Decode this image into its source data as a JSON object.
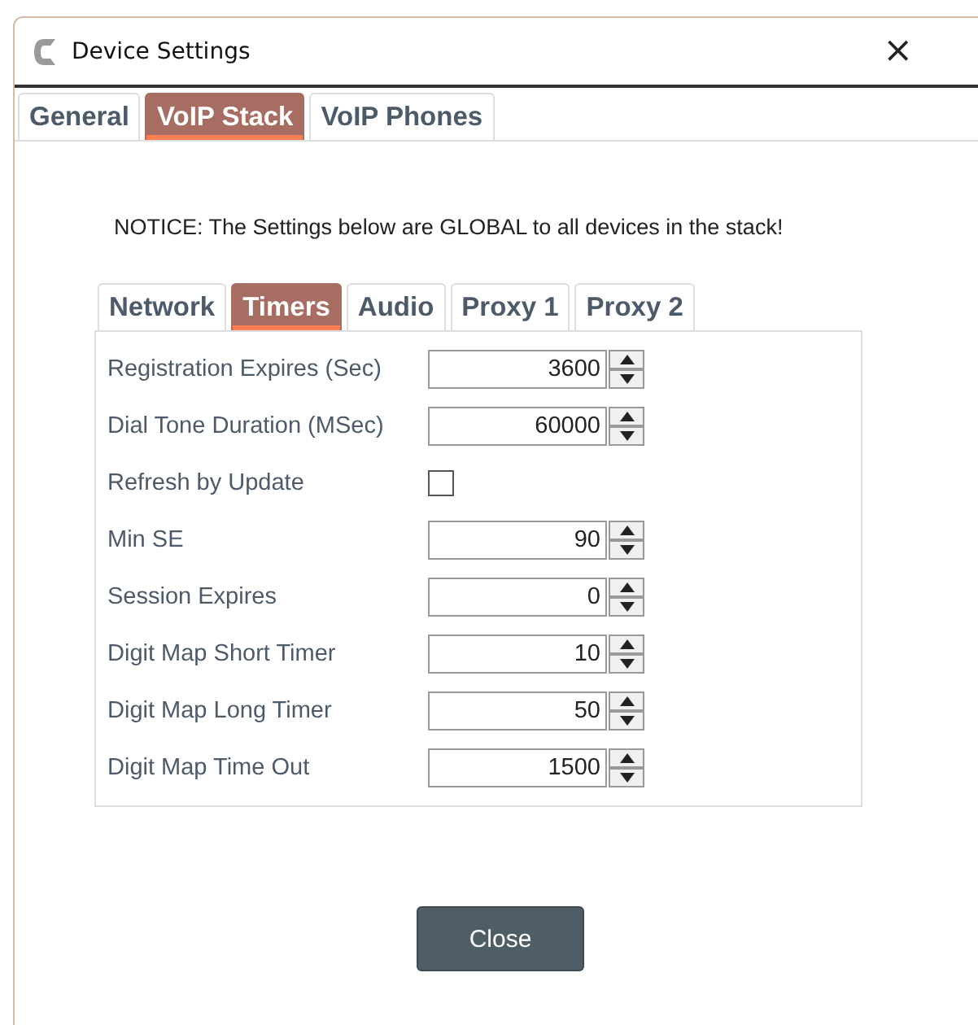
{
  "window": {
    "title": "Device Settings",
    "close": "×"
  },
  "tabs": [
    {
      "label": "General",
      "selected": false
    },
    {
      "label": "VoIP Stack",
      "selected": true
    },
    {
      "label": "VoIP Phones",
      "selected": false
    }
  ],
  "notice": "NOTICE: The Settings below are GLOBAL to all devices in the stack!",
  "subtabs": [
    {
      "label": "Network",
      "selected": false
    },
    {
      "label": "Timers",
      "selected": true
    },
    {
      "label": "Audio",
      "selected": false
    },
    {
      "label": "Proxy 1",
      "selected": false
    },
    {
      "label": "Proxy 2",
      "selected": false
    }
  ],
  "fields": [
    {
      "kind": "spinner",
      "label": "Registration Expires (Sec)",
      "value": "3600"
    },
    {
      "kind": "spinner",
      "label": "Dial Tone Duration (MSec)",
      "value": "60000"
    },
    {
      "kind": "checkbox",
      "label": "Refresh by Update",
      "checked": false
    },
    {
      "kind": "spinner",
      "label": "Min SE",
      "value": "90"
    },
    {
      "kind": "spinner",
      "label": "Session Expires",
      "value": "0"
    },
    {
      "kind": "spinner",
      "label": "Digit Map Short Timer",
      "value": "10"
    },
    {
      "kind": "spinner",
      "label": "Digit Map Long Timer",
      "value": "50"
    },
    {
      "kind": "spinner",
      "label": "Digit Map Time Out",
      "value": "1500"
    }
  ],
  "close_button": "Close"
}
